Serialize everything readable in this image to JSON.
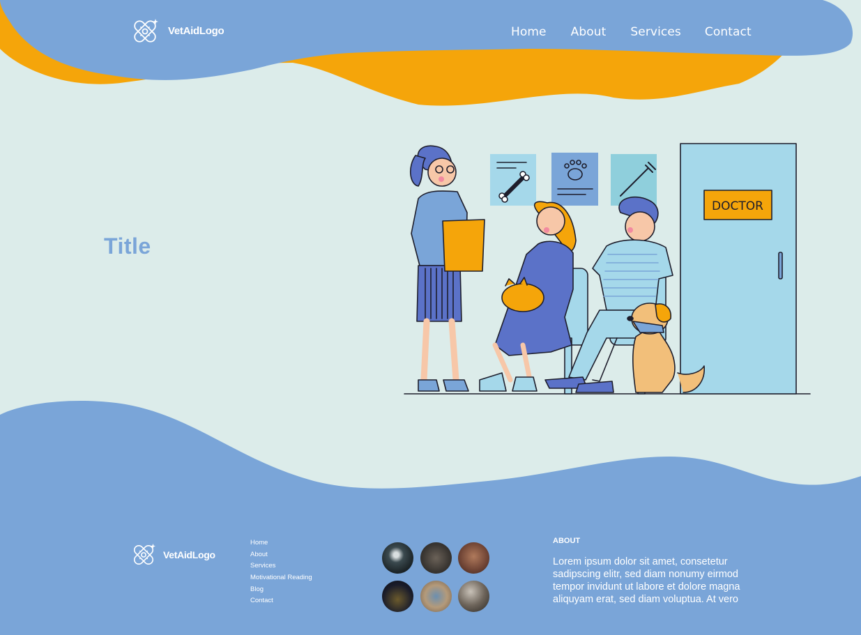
{
  "header": {
    "logo_text": "VetAidLogo",
    "nav": [
      "Home",
      "About",
      "Services",
      "Contact"
    ]
  },
  "hero": {
    "title": "Title",
    "door_sign": "DOCTOR"
  },
  "footer": {
    "logo_text": "VetAidLogo",
    "links": [
      "Home",
      "About",
      "Services",
      "Motivational Reading",
      "Blog",
      "Contact"
    ],
    "about_heading": "ABOUT",
    "about_text": "Lorem ipsum dolor sit amet, consetetur sadipscing elitr, sed diam nonumy eirmod tempor invidunt ut labore et dolore magna aliquyam erat, sed diam voluptua. At vero"
  },
  "colors": {
    "primary_blue": "#7aa5d8",
    "accent_orange": "#f5a50a",
    "background": "#dcecea"
  }
}
